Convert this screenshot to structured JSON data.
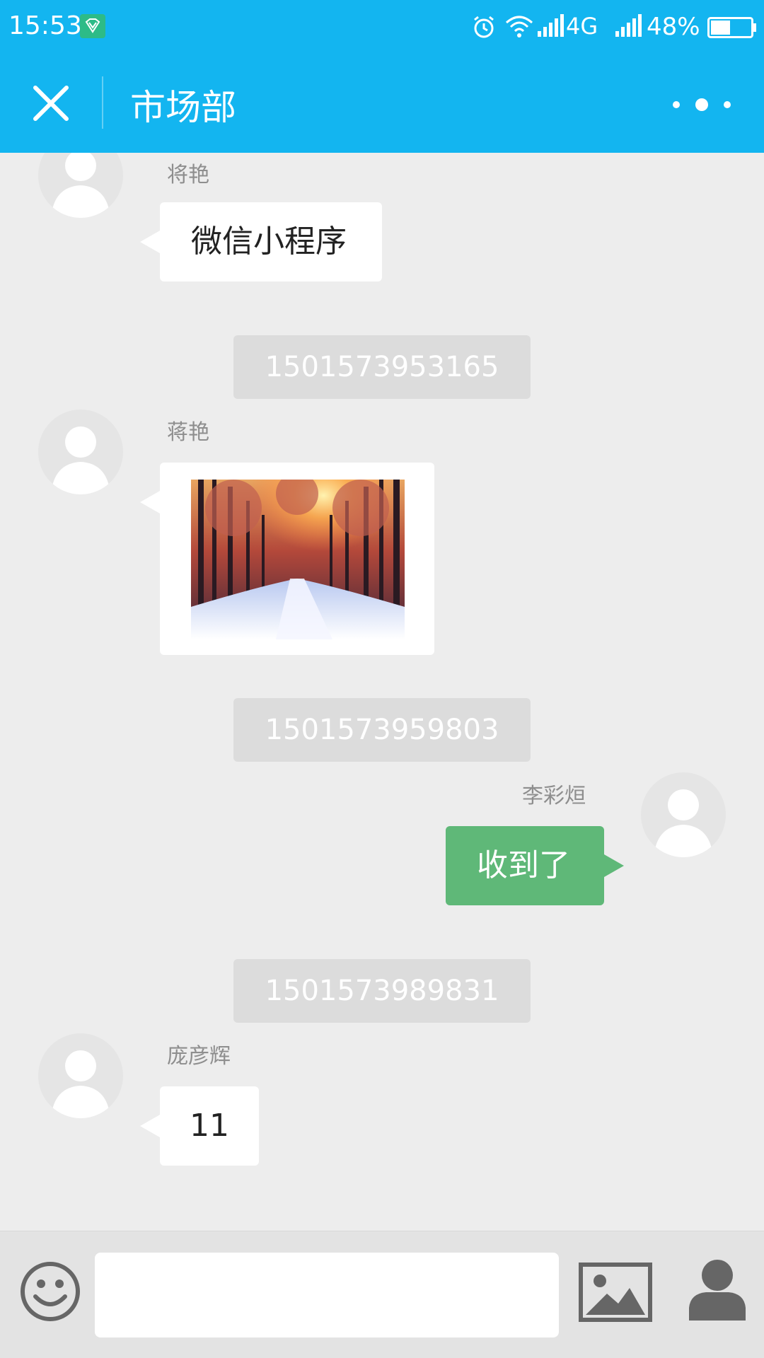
{
  "status_bar": {
    "time": "15:53",
    "network": "4G",
    "battery_percent": "48%",
    "battery_level": 0.48
  },
  "header": {
    "title": "市场部",
    "close_icon": "close-icon",
    "more_icon": "more-icon"
  },
  "messages": [
    {
      "type": "text",
      "side": "left",
      "sender": "将艳",
      "text": "微信小程序"
    },
    {
      "type": "timestamp",
      "text": "1501573953165"
    },
    {
      "type": "image",
      "side": "left",
      "sender": "蒋艳",
      "image": "snowy-forest-photo"
    },
    {
      "type": "timestamp",
      "text": "1501573959803"
    },
    {
      "type": "text",
      "side": "right",
      "sender": "李彩烜",
      "text": "收到了"
    },
    {
      "type": "timestamp",
      "text": "1501573989831"
    },
    {
      "type": "text",
      "side": "left",
      "sender": "庞彦辉",
      "text": "11"
    }
  ],
  "input_bar": {
    "value": "",
    "emoji_icon": "emoji-icon",
    "image_icon": "image-icon",
    "contact_icon": "contact-icon"
  },
  "colors": {
    "header": "#13b5f0",
    "sent_bubble": "#5fb878",
    "background": "#ededed"
  }
}
